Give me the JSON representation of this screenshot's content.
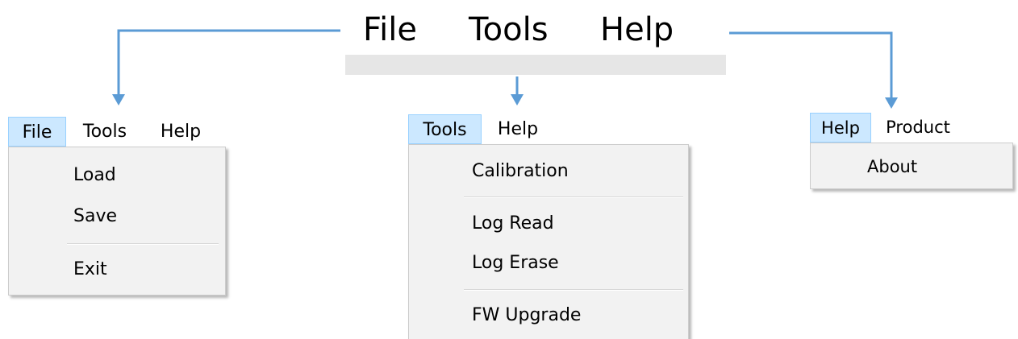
{
  "top_menu": {
    "file_label": "File",
    "tools_label": "Tools",
    "help_label": "Help"
  },
  "file_menu": {
    "bar": {
      "file": "File",
      "tools": "Tools",
      "help": "Help"
    },
    "items": {
      "load": "Load",
      "save": "Save",
      "exit": "Exit"
    }
  },
  "tools_menu": {
    "bar": {
      "tools": "Tools",
      "help": "Help"
    },
    "items": {
      "calibration": "Calibration",
      "log_read": "Log Read",
      "log_erase": "Log Erase",
      "fw_upgrade": "FW Upgrade"
    }
  },
  "help_menu": {
    "bar": {
      "help": "Help",
      "product": "Product"
    },
    "items": {
      "about": "About"
    }
  },
  "colors": {
    "connector": "#5b9bd5",
    "active_bg": "#cce8ff",
    "active_border": "#99d1ff",
    "menu_bg": "#f2f2f2"
  }
}
